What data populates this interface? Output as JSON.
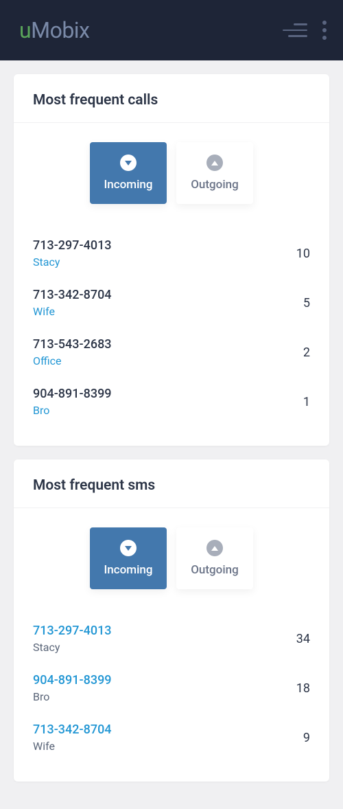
{
  "brand": {
    "prefix": "u",
    "suffix": "Mobix"
  },
  "calls_card": {
    "title": "Most frequent calls",
    "tabs": {
      "incoming": "Incoming",
      "outgoing": "Outgoing"
    },
    "items": [
      {
        "number": "713-297-4013",
        "name": "Stacy",
        "count": "10"
      },
      {
        "number": "713-342-8704",
        "name": "Wife",
        "count": "5"
      },
      {
        "number": "713-543-2683",
        "name": "Office",
        "count": "2"
      },
      {
        "number": "904-891-8399",
        "name": "Bro",
        "count": "1"
      }
    ]
  },
  "sms_card": {
    "title": "Most frequent sms",
    "tabs": {
      "incoming": "Incoming",
      "outgoing": "Outgoing"
    },
    "items": [
      {
        "number": "713-297-4013",
        "name": "Stacy",
        "count": "34"
      },
      {
        "number": "904-891-8399",
        "name": "Bro",
        "count": "18"
      },
      {
        "number": "713-342-8704",
        "name": "Wife",
        "count": "9"
      }
    ]
  }
}
